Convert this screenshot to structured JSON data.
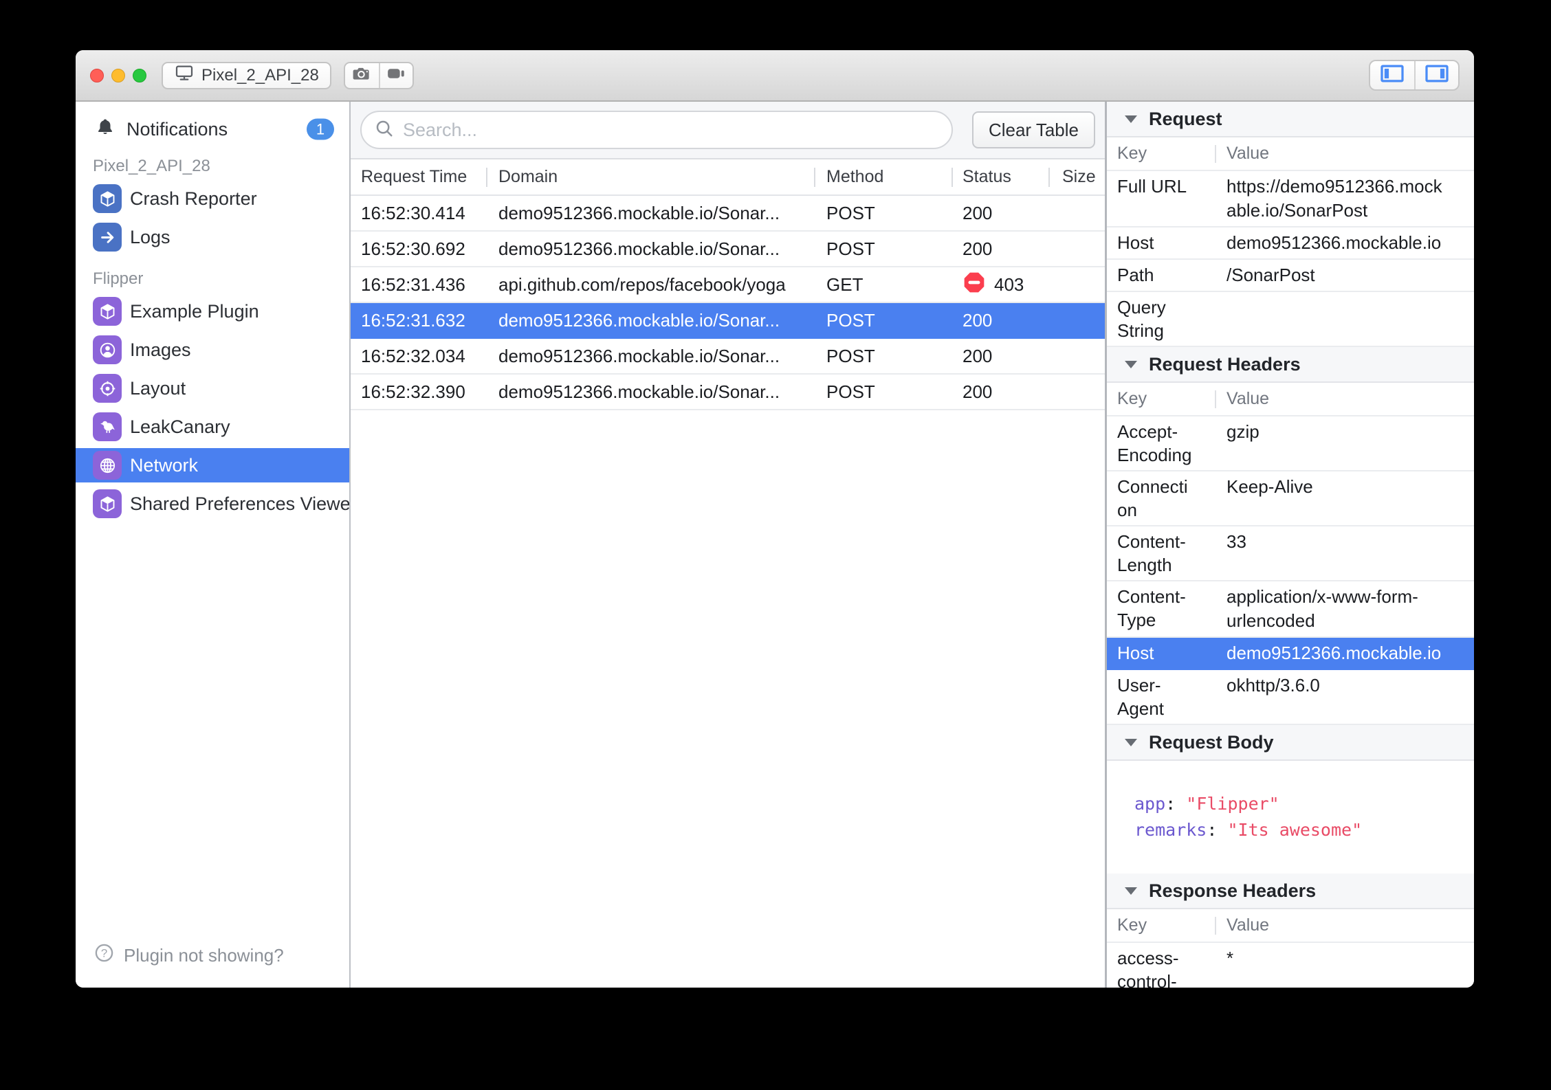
{
  "titlebar": {
    "device_button_label": "Pixel_2_API_28"
  },
  "sidebar": {
    "notifications": {
      "label": "Notifications",
      "badge": "1"
    },
    "device_section_label": "Pixel_2_API_28",
    "flipper_section_label": "Flipper",
    "items": [
      {
        "label": "Crash Reporter"
      },
      {
        "label": "Logs"
      },
      {
        "label": "Example Plugin"
      },
      {
        "label": "Images"
      },
      {
        "label": "Layout"
      },
      {
        "label": "LeakCanary"
      },
      {
        "label": "Network"
      },
      {
        "label": "Shared Preferences Viewer"
      }
    ],
    "footer_label": "Plugin not showing?"
  },
  "toolbar": {
    "search_placeholder": "Search...",
    "clear_button_label": "Clear Table"
  },
  "table": {
    "columns": [
      "Request Time",
      "Domain",
      "Method",
      "Status",
      "Size"
    ],
    "rows": [
      {
        "time": "16:52:30.414",
        "domain": "demo9512366.mockable.io/Sonar...",
        "method": "POST",
        "status": "200",
        "size": ""
      },
      {
        "time": "16:52:30.692",
        "domain": "demo9512366.mockable.io/Sonar...",
        "method": "POST",
        "status": "200",
        "size": ""
      },
      {
        "time": "16:52:31.436",
        "domain": "api.github.com/repos/facebook/yoga",
        "method": "GET",
        "status": "403",
        "size": ""
      },
      {
        "time": "16:52:31.632",
        "domain": "demo9512366.mockable.io/Sonar...",
        "method": "POST",
        "status": "200",
        "size": ""
      },
      {
        "time": "16:52:32.034",
        "domain": "demo9512366.mockable.io/Sonar...",
        "method": "POST",
        "status": "200",
        "size": ""
      },
      {
        "time": "16:52:32.390",
        "domain": "demo9512366.mockable.io/Sonar...",
        "method": "POST",
        "status": "200",
        "size": ""
      }
    ]
  },
  "details": {
    "request": {
      "title": "Request",
      "key_col": "Key",
      "value_col": "Value",
      "rows": [
        {
          "key": "Full URL",
          "value": "https://demo9512366.mockable.io/SonarPost"
        },
        {
          "key": "Host",
          "value": "demo9512366.mockable.io"
        },
        {
          "key": "Path",
          "value": "/SonarPost"
        },
        {
          "key": "Query String",
          "value": ""
        }
      ]
    },
    "request_headers": {
      "title": "Request Headers",
      "key_col": "Key",
      "value_col": "Value",
      "rows": [
        {
          "key": "Accept-Encoding",
          "value": "gzip"
        },
        {
          "key": "Connection",
          "value": "Keep-Alive"
        },
        {
          "key": "Content-Length",
          "value": "33"
        },
        {
          "key": "Content-Type",
          "value": "application/x-www-form-urlencoded"
        },
        {
          "key": "Host",
          "value": "demo9512366.mockable.io"
        },
        {
          "key": "User-Agent",
          "value": "okhttp/3.6.0"
        }
      ]
    },
    "request_body": {
      "title": "Request Body",
      "lines": [
        {
          "key": "app",
          "sep": ": ",
          "value": "\"Flipper\""
        },
        {
          "key": "remarks",
          "sep": ": ",
          "value": "\"Its awesome\""
        }
      ]
    },
    "response_headers": {
      "title": "Response Headers",
      "key_col": "Key",
      "value_col": "Value",
      "rows": [
        {
          "key": "access-control-",
          "value": "*"
        }
      ]
    }
  },
  "colors": {
    "selection_blue": "#4a80f0",
    "badge_blue": "#4a90e8",
    "plugin_icon_blue": "#4a72c4",
    "plugin_icon_purple": "#8c64d9",
    "error_red": "#fb3e4e",
    "toggle_icon_blue": "#4a8cf7"
  }
}
